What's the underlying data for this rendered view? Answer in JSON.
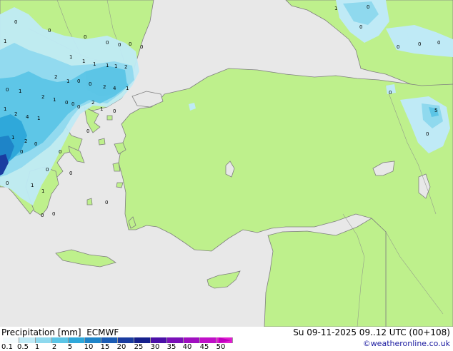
{
  "title": "Precipitation [mm]",
  "model": "ECMWF",
  "datetime": "Su 09-11-2025 09..12 UTC (00+108)",
  "credit": "©weatheronline.co.uk",
  "legend": {
    "ticks": [
      "0.1",
      "0.5",
      "1",
      "2",
      "5",
      "10",
      "15",
      "20",
      "25",
      "30",
      "35",
      "40",
      "45",
      "50"
    ],
    "colors": [
      "#f4fbfd",
      "#bfeaf6",
      "#8fd9ee",
      "#5cc5e6",
      "#2fa8da",
      "#1e84c8",
      "#1b5cb4",
      "#1a3ca0",
      "#16208c",
      "#4b10a8",
      "#7a10b8",
      "#a010c0",
      "#c010c8",
      "#e020d0"
    ]
  },
  "colors": {
    "sea": "#e8e8e8",
    "land": "#bef08c",
    "coast": "#7f7f7f"
  },
  "map_values": [
    "0",
    "0",
    "1",
    "0",
    "0",
    "0",
    "1",
    "1",
    "1",
    "1",
    "1",
    "2",
    "1",
    "0",
    "0",
    "2",
    "4",
    "2",
    "1",
    "0",
    "1",
    "2",
    "1",
    "0",
    "2",
    "0",
    "1",
    "1",
    "4",
    "2",
    "1",
    "0",
    "0",
    "1",
    "2",
    "0",
    "0",
    "0",
    "0",
    "0",
    "1",
    "1",
    "0",
    "0",
    "0",
    "0",
    "0",
    "5",
    "0",
    "0",
    "0",
    "0",
    "0",
    "0",
    "1",
    "0",
    "0",
    "0"
  ]
}
